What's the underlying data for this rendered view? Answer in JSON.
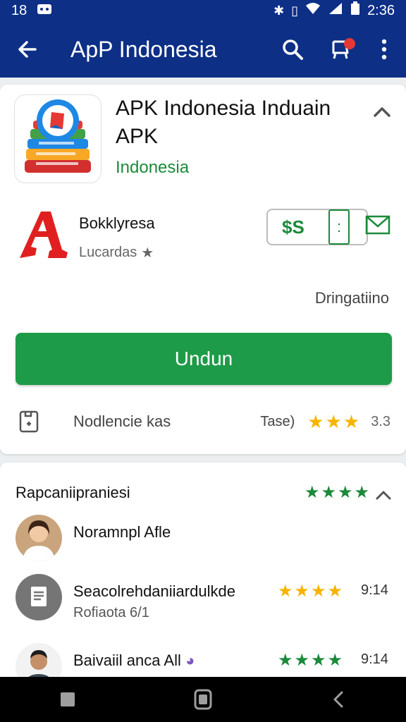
{
  "status_bar": {
    "left_text": "18",
    "time": "2:36"
  },
  "app_bar": {
    "title": "ApP Indonesia"
  },
  "app": {
    "title": "APK Indonesia Induain APK",
    "subtitle": "Indonesia"
  },
  "developer": {
    "name": "Bokklyresa",
    "subtitle": "Lucardas",
    "price": "$S",
    "price_sub": ":"
  },
  "status_text": "Dringatiino",
  "install_label": "Undun",
  "info": {
    "label": "Nodlencie kas",
    "rating_label": "Tase)",
    "rating_value": "3.3",
    "star_color": "#f6b400"
  },
  "reviews_section": {
    "title": "Rapcaniipraniesi",
    "star_color": "#1b8a3a",
    "items": [
      {
        "name": "Noramnpl Afle",
        "subtitle": "",
        "value": "",
        "stars": 0
      },
      {
        "name": "Seacolrehdaniiardulkde",
        "subtitle": "Rofiaota 6/1",
        "value": "9:14",
        "stars": 4,
        "star_color": "#f6b400"
      },
      {
        "name": "Baivaiil anca All",
        "subtitle": "",
        "value": "9:14",
        "stars": 4,
        "star_color": "#1b8a3a"
      }
    ]
  },
  "icons": {
    "back": "arrow-left-icon",
    "search": "search-icon",
    "notifications": "notification-icon",
    "more": "more-vert-icon"
  }
}
